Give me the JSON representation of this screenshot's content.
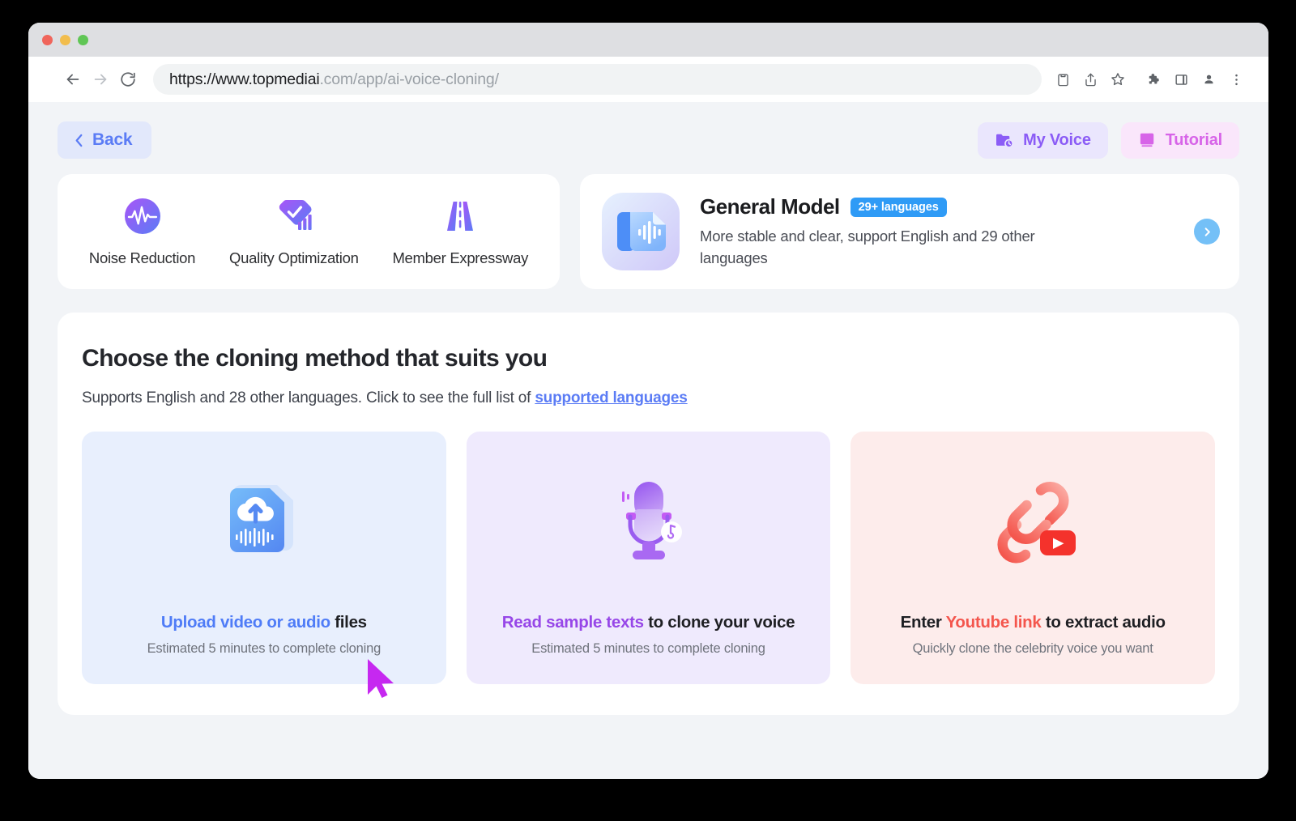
{
  "browser": {
    "url_prefix": "https://www.topmediai",
    "url_suffix": ".com/app/ai-voice-cloning/",
    "back_icon": "back-arrow-icon",
    "forward_icon": "forward-arrow-icon",
    "reload_icon": "reload-icon",
    "toolbar_icons": [
      "clipboard-icon",
      "share-icon",
      "bookmark-star-icon",
      "extensions-puzzle-icon",
      "side-panel-icon",
      "profile-avatar-icon",
      "more-menu-icon"
    ],
    "traffic_lights": [
      "close-red",
      "minimize-yellow",
      "maximize-green"
    ]
  },
  "header": {
    "back_label": "Back",
    "back_icon": "chevron-left-icon",
    "my_voice_label": "My Voice",
    "my_voice_icon": "folder-clock-icon",
    "tutorial_label": "Tutorial",
    "tutorial_icon": "book-icon"
  },
  "features": [
    {
      "label": "Noise Reduction",
      "icon": "waveform-circle-icon"
    },
    {
      "label": "Quality Optimization",
      "icon": "diamond-check-chart-icon"
    },
    {
      "label": "Member Expressway",
      "icon": "highway-road-icon"
    }
  ],
  "model": {
    "title": "General Model",
    "badge": "29+ languages",
    "description": "More stable and clear, support English and 29 other languages",
    "thumb_icon": "document-waveform-icon",
    "arrow_icon": "chevron-right-icon"
  },
  "main": {
    "title": "Choose the cloning method that suits you",
    "subtitle_before": "Supports English and 28 other languages. Click to see the full list of ",
    "subtitle_link": "supported languages",
    "methods": [
      {
        "title_highlight": "Upload video or audio",
        "title_rest": " files",
        "subtitle": "Estimated 5 minutes to complete cloning",
        "icon": "file-cloud-upload-waveform-icon",
        "theme": "upload"
      },
      {
        "title_highlight": "Read sample texts",
        "title_rest": " to clone your voice",
        "subtitle": "Estimated 5 minutes to complete cloning",
        "icon": "microphone-icon",
        "theme": "read"
      },
      {
        "title_prefix": "Enter ",
        "title_highlight": "Youtube link",
        "title_rest": " to extract audio",
        "subtitle": "Quickly clone the celebrity voice you want",
        "icon": "chain-link-youtube-icon",
        "theme": "yt"
      }
    ]
  },
  "cursor": {
    "icon": "mouse-pointer-icon",
    "color": "#c628f0"
  },
  "colors": {
    "page_bg": "#f2f4f7",
    "accent_blue": "#5b7cf5",
    "accent_purple": "#8b5cf6",
    "accent_pink": "#d764e8",
    "badge_blue": "#2f9bf6",
    "youtube_red": "#f4564d"
  }
}
